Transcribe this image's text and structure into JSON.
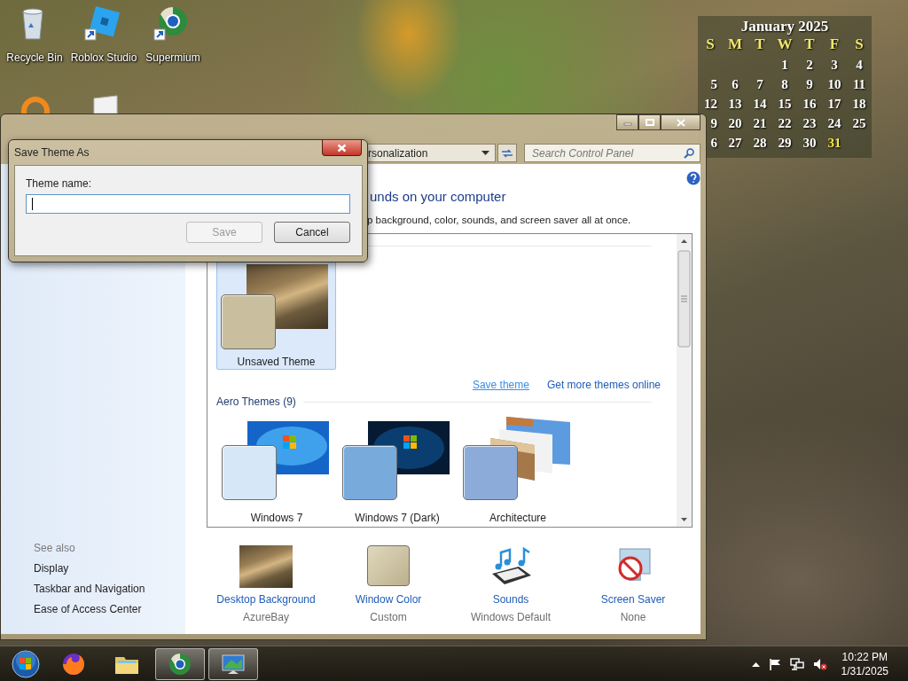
{
  "desktop_icons": [
    {
      "label": "Recycle Bin",
      "kind": "bin",
      "shortcut": false
    },
    {
      "label": "Roblox Studio",
      "kind": "tilted",
      "shortcut": true
    },
    {
      "label": "Supermium",
      "kind": "ring",
      "shortcut": true
    }
  ],
  "partial_desktop_icons": [
    {
      "kind": "circle"
    },
    {
      "kind": "page"
    }
  ],
  "calendar_gadget": {
    "title": "January 2025",
    "weekdays": [
      "S",
      "M",
      "T",
      "W",
      "T",
      "F",
      "S"
    ],
    "weeks": [
      [
        {
          "day": "1",
          "today": false
        },
        {
          "day": "2",
          "today": false
        },
        {
          "day": "3",
          "today": false
        },
        {
          "day": "4",
          "today": false
        }
      ],
      [
        {
          "day": "5",
          "today": false
        },
        {
          "day": "6",
          "today": false
        },
        {
          "day": "7",
          "today": false
        },
        {
          "day": "8",
          "today": false
        },
        {
          "day": "9",
          "today": false
        },
        {
          "day": "10",
          "today": false
        },
        {
          "day": "11",
          "today": false
        }
      ],
      [
        {
          "day": "12",
          "today": false
        },
        {
          "day": "13",
          "today": false
        },
        {
          "day": "14",
          "today": false
        },
        {
          "day": "15",
          "today": false
        },
        {
          "day": "16",
          "today": false
        },
        {
          "day": "17",
          "today": false
        },
        {
          "day": "18",
          "today": false
        }
      ],
      [
        {
          "day": "9",
          "today": false
        },
        {
          "day": "20",
          "today": false
        },
        {
          "day": "21",
          "today": false
        },
        {
          "day": "22",
          "today": false
        },
        {
          "day": "23",
          "today": false
        },
        {
          "day": "24",
          "today": false
        },
        {
          "day": "25",
          "today": false
        }
      ],
      [
        {
          "day": "6",
          "today": false
        },
        {
          "day": "27",
          "today": false
        },
        {
          "day": "28",
          "today": false
        },
        {
          "day": "29",
          "today": false
        },
        {
          "day": "30",
          "today": false
        },
        {
          "day": "31",
          "today": true
        }
      ]
    ]
  },
  "control_panel": {
    "address": "rsonalization",
    "search": {
      "placeholder": "Search Control Panel"
    },
    "heading": "unds on your computer",
    "description": "p background, color, sounds, and screen saver all at once.",
    "my_themes": [
      {
        "name": "Unsaved Theme",
        "kind": "photo",
        "color": "#c9bf9f",
        "selected": true
      }
    ],
    "links": [
      {
        "text": "Save theme",
        "hovered": true
      },
      {
        "text": "Get more themes online",
        "hovered": false
      }
    ],
    "aero_header": "Aero Themes (9)",
    "aero_themes": [
      {
        "name": "Windows 7",
        "kind": "bright",
        "color": "#d6e8f7",
        "selected": false
      },
      {
        "name": "Windows 7 (Dark)",
        "kind": "dark",
        "color": "#78abdc",
        "selected": false
      },
      {
        "name": "Architecture",
        "kind": "stack",
        "color": "#8cabd9",
        "selected": false
      }
    ],
    "see_also": {
      "title": "See also",
      "links": [
        "Display",
        "Taskbar and Navigation",
        "Ease of Access Center"
      ]
    },
    "settings": [
      {
        "label": "Desktop Background",
        "value": "AzureBay",
        "kind": "photo"
      },
      {
        "label": "Window Color",
        "value": "Custom",
        "kind": "swatch"
      },
      {
        "label": "Sounds",
        "value": "Windows Default",
        "kind": "notes"
      },
      {
        "label": "Screen Saver",
        "value": "None",
        "kind": "nosign"
      }
    ]
  },
  "dialog": {
    "title": "Save Theme As",
    "field_label": "Theme name:",
    "field_focused": true,
    "buttons": [
      {
        "label": "Save",
        "disabled": true
      },
      {
        "label": "Cancel",
        "disabled": false
      }
    ]
  },
  "taskbar": {
    "items": [
      {
        "kind": "browser",
        "running": false
      },
      {
        "kind": "folder",
        "running": false
      },
      {
        "kind": "ring",
        "running": true
      },
      {
        "kind": "monitor",
        "running": true
      }
    ],
    "tray": [
      {
        "kind": "caret"
      },
      {
        "kind": "flag"
      },
      {
        "kind": "network"
      },
      {
        "kind": "muted"
      }
    ],
    "time": "10:22 PM",
    "date": "1/31/2025"
  }
}
